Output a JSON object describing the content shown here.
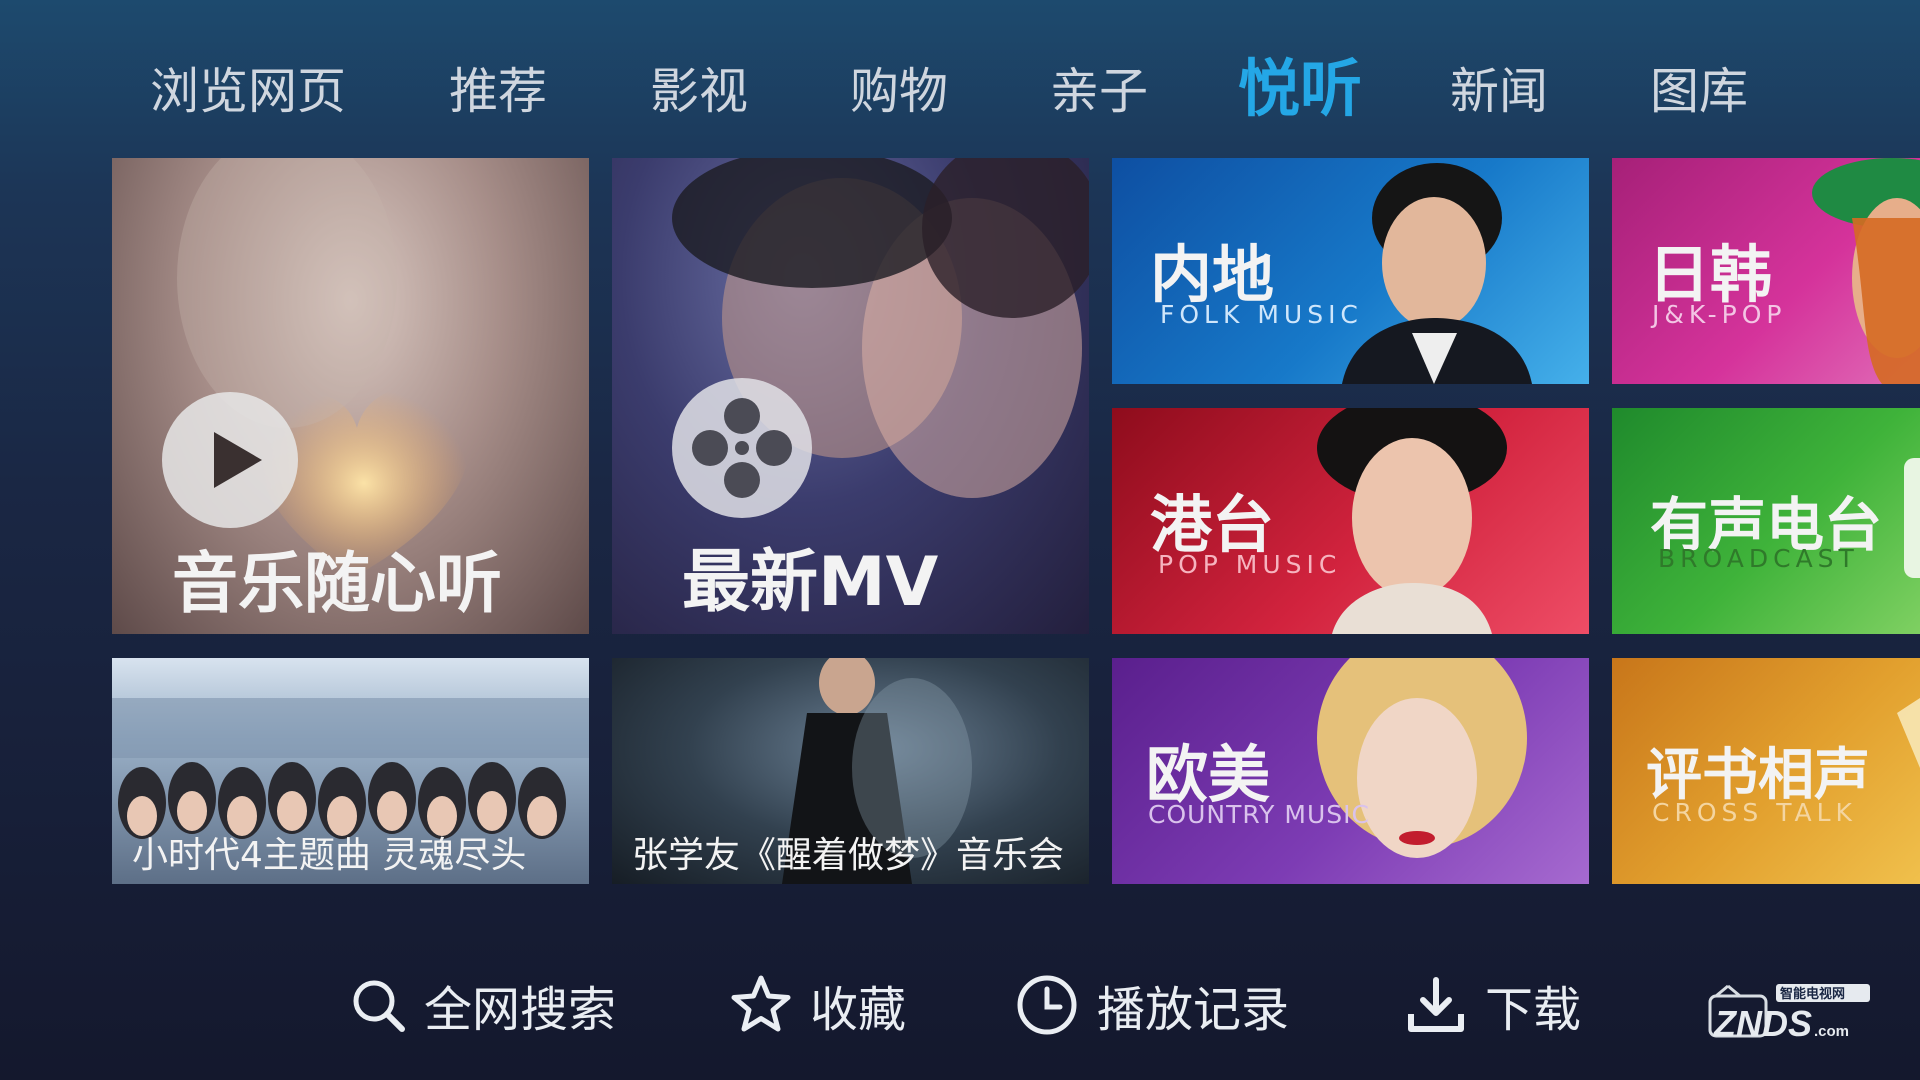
{
  "nav": {
    "items": [
      "浏览网页",
      "推荐",
      "影视",
      "购物",
      "亲子",
      "悦听",
      "新闻",
      "图库"
    ],
    "active": "悦听"
  },
  "tiles": {
    "music": {
      "title": "音乐随心听"
    },
    "mv": {
      "title": "最新MV"
    },
    "mainland": {
      "title": "内地",
      "subtitle": "FOLK MUSIC"
    },
    "jk": {
      "title": "日韩",
      "subtitle": "J&K-POP"
    },
    "hktw": {
      "title": "港台",
      "subtitle": "POP MUSIC"
    },
    "radio": {
      "title": "有声电台",
      "subtitle": "BROADCAST"
    },
    "tiny": {
      "caption": "小时代4主题曲 灵魂尽头"
    },
    "concert": {
      "caption": "张学友《醒着做梦》音乐会"
    },
    "western": {
      "title": "欧美",
      "subtitle": "COUNTRY MUSIC"
    },
    "crosstalk": {
      "title": "评书相声",
      "subtitle": "CROSS TALK"
    }
  },
  "bottom": {
    "search": "全网搜索",
    "favorites": "收藏",
    "history": "播放记录",
    "download": "下载"
  },
  "brand": {
    "name": "ZNDS",
    "domain": ".com",
    "tag": "智能电视网"
  },
  "colors": {
    "active_tab": "#24a7e6",
    "mainland": "#1779c9",
    "jk": "#d5339b",
    "hktw": "#d2233e",
    "radio": "#3fb33a",
    "western": "#7d3cb4",
    "crosstalk": "#e2a02e"
  }
}
